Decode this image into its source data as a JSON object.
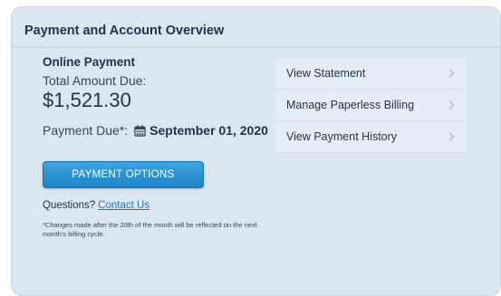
{
  "panel": {
    "title": "Payment and Account Overview"
  },
  "online_payment": {
    "title": "Online Payment",
    "total_label": "Total Amount Due:",
    "total_amount": "$1,521.30",
    "due_label": "Payment Due*:",
    "due_date": "September 01, 2020",
    "calendar_icon": "calendar-icon",
    "button_label": "PAYMENT OPTIONS",
    "questions_label": "Questions?",
    "contact_link": "Contact Us",
    "footnote": "*Changes made after the 20th of the month will be reflected on the next month's billing cycle."
  },
  "links": [
    {
      "label": "View Statement",
      "icon": "chevron-right-icon"
    },
    {
      "label": "Manage Paperless Billing",
      "icon": "chevron-right-icon"
    },
    {
      "label": "View Payment History",
      "icon": "chevron-right-icon"
    }
  ],
  "colors": {
    "panel_bg": "#dbe6f1",
    "button_bg": "#2a94d4",
    "link_color": "#1d7cc0",
    "text_dark": "#24324a"
  }
}
